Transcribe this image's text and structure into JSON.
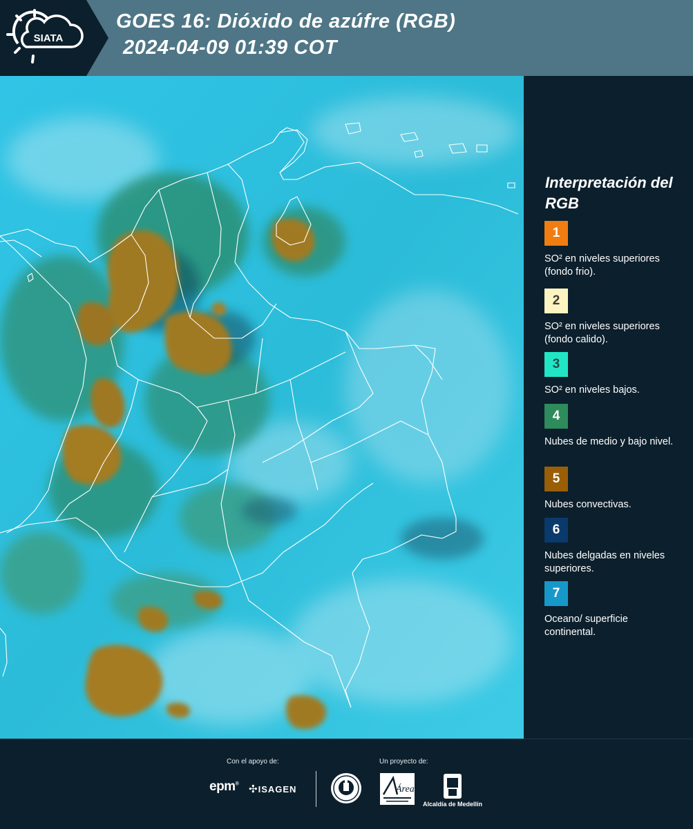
{
  "header": {
    "logo_text": "SIATA",
    "title_line1": "GOES 16: Dióxido de azúfre (RGB)",
    "title_line2": "2024-04-09 01:39 COT"
  },
  "legend": {
    "title": "Interpretación del RGB",
    "items": [
      {
        "number": "1",
        "color": "#f07d12",
        "text_color": "#ffffff",
        "description": "SO² en niveles superiores (fondo frio)."
      },
      {
        "number": "2",
        "color": "#fdf5c1",
        "text_color": "#3b3b3b",
        "description": "SO² en niveles superiores (fondo calido)."
      },
      {
        "number": "3",
        "color": "#21e6c6",
        "text_color": "#1f4f4a",
        "description": "SO² en niveles bajos."
      },
      {
        "number": "4",
        "color": "#2e8b5c",
        "text_color": "#ffffff",
        "description": "Nubes de medio y bajo nivel."
      },
      {
        "number": "5",
        "color": "#9a5e07",
        "text_color": "#ffffff",
        "description": "Nubes convectivas."
      },
      {
        "number": "6",
        "color": "#0a3a6b",
        "text_color": "#ffffff",
        "description": "Nubes delgadas en niveles superiores."
      },
      {
        "number": "7",
        "color": "#1699c9",
        "text_color": "#ffffff",
        "description": "Oceano/ superficie continental."
      }
    ]
  },
  "footer": {
    "support_label": "Con el apoyo de:",
    "project_label": "Un proyecto de:",
    "sponsor_epm": "epm",
    "sponsor_isagen": "ISAGEN",
    "partner_area": "Área",
    "partner_alcaldia": "Alcaldía de Medellín"
  },
  "colors": {
    "header_bg": "#4f7686",
    "panel_bg": "#0c1f2c",
    "map_base": "#27bfe0",
    "convective_cloud": "#a0781e"
  }
}
